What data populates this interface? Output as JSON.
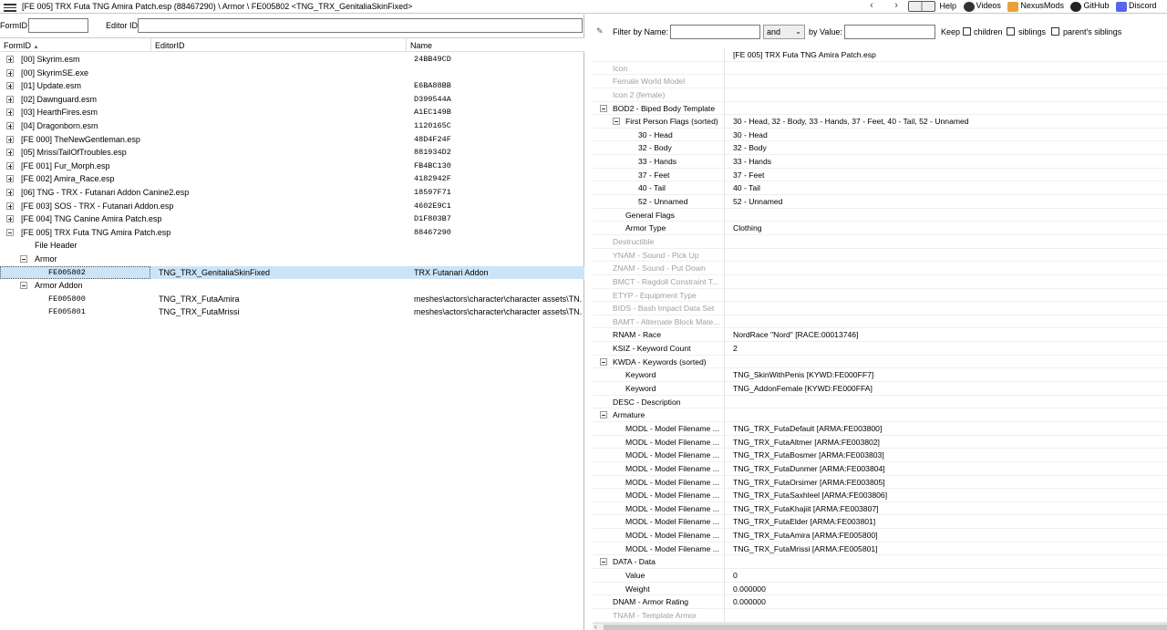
{
  "topbar": {
    "path": "[FE 005] TRX Futa TNG Amira Patch.esp (88467290) \\ Armor \\ FE005802 <TNG_TRX_GenitaliaSkinFixed>",
    "back": "‹",
    "forward": "›",
    "links": [
      {
        "label": "Help",
        "icon": "book-icon"
      },
      {
        "label": "Videos",
        "icon": "video-icon"
      },
      {
        "label": "NexusMods",
        "icon": "nexusmods-icon"
      },
      {
        "label": "GitHub",
        "icon": "github-icon"
      },
      {
        "label": "Discord",
        "icon": "discord-icon"
      }
    ]
  },
  "left": {
    "formid_label": "FormID",
    "editorid_label": "Editor ID",
    "formid_value": "",
    "editorid_value": "",
    "columns": [
      "FormID",
      "EditorID",
      "Name"
    ],
    "sort_indicator": "▲",
    "rows": [
      {
        "c1": "[00] Skyrim.esm",
        "c3": "24BB49CD",
        "indent": 0,
        "exp": "plus"
      },
      {
        "c1": "[00] SkyrimSE.exe",
        "c3": "",
        "indent": 0,
        "exp": "plus"
      },
      {
        "c1": "[01] Update.esm",
        "c3": "E6BA88BB",
        "indent": 0,
        "exp": "plus"
      },
      {
        "c1": "[02] Dawnguard.esm",
        "c3": "D399544A",
        "indent": 0,
        "exp": "plus"
      },
      {
        "c1": "[03] HearthFires.esm",
        "c3": "A1EC149B",
        "indent": 0,
        "exp": "plus"
      },
      {
        "c1": "[04] Dragonborn.esm",
        "c3": "1120165C",
        "indent": 0,
        "exp": "plus"
      },
      {
        "c1": "[FE 000] TheNewGentleman.esp",
        "c3": "48D4F24F",
        "indent": 0,
        "exp": "plus"
      },
      {
        "c1": "[05] MrissiTailOfTroubles.esp",
        "c3": "881934D2",
        "indent": 0,
        "exp": "plus"
      },
      {
        "c1": "[FE 001] Fur_Morph.esp",
        "c3": "FB4BC130",
        "indent": 0,
        "exp": "plus"
      },
      {
        "c1": "[FE 002] Amira_Race.esp",
        "c3": "4182942F",
        "indent": 0,
        "exp": "plus"
      },
      {
        "c1": "[06] TNG - TRX - Futanari Addon Canine2.esp",
        "c3": "18597F71",
        "indent": 0,
        "exp": "plus"
      },
      {
        "c1": "[FE 003] SOS - TRX - Futanari Addon.esp",
        "c3": "4602E9C1",
        "indent": 0,
        "exp": "plus"
      },
      {
        "c1": "[FE 004] TNG Canine Amira Patch.esp",
        "c3": "D1F803B7",
        "indent": 0,
        "exp": "plus"
      },
      {
        "c1": "[FE 005] TRX Futa TNG Amira Patch.esp",
        "c3": "88467290",
        "indent": 0,
        "exp": "minus"
      },
      {
        "c1": "File Header",
        "c3": "",
        "indent": 1,
        "exp": "none"
      },
      {
        "c1": "Armor",
        "c3": "",
        "indent": 1,
        "exp": "minus"
      },
      {
        "c1": "FE005802",
        "c2": "TNG_TRX_GenitaliaSkinFixed",
        "c3": "TRX Futanari Addon",
        "indent": 2,
        "exp": "none",
        "selected": true
      },
      {
        "c1": "Armor Addon",
        "c3": "",
        "indent": 1,
        "exp": "minus"
      },
      {
        "c1": "FE005800",
        "c2": "TNG_TRX_FutaAmira",
        "c3": "meshes\\actors\\character\\character assets\\TN...",
        "indent": 2,
        "exp": "none"
      },
      {
        "c1": "FE005801",
        "c2": "TNG_TRX_FutaMrissi",
        "c3": "meshes\\actors\\character\\character assets\\TN...",
        "indent": 2,
        "exp": "none"
      }
    ]
  },
  "right": {
    "filter_name_label": "Filter by Name:",
    "filter_name_value": "",
    "op_value": "and",
    "filter_value_label": "by Value:",
    "filter_value_value": "",
    "keep_label": "Keep",
    "children_label": "children",
    "siblings_label": "siblings",
    "parents_siblings_label": "parent's siblings",
    "rows": [
      {
        "k": "",
        "v": "[FE 005] TRX Futa TNG Amira Patch.esp",
        "level": 0
      },
      {
        "k": "Icon",
        "v": "",
        "level": 0,
        "dis": true
      },
      {
        "k": "Female World Model",
        "v": "",
        "level": 0,
        "dis": true
      },
      {
        "k": "Icon 2 (female)",
        "v": "",
        "level": 0,
        "dis": true
      },
      {
        "k": "BOD2 - Biped Body Template",
        "v": "",
        "level": 0,
        "exp": true
      },
      {
        "k": "First Person Flags (sorted)",
        "v": "30 - Head, 32 - Body, 33 - Hands, 37 - Feet, 40 - Tail, 52 - Unnamed",
        "level": 1,
        "exp": true
      },
      {
        "k": "30 - Head",
        "v": "30 - Head",
        "level": 2
      },
      {
        "k": "32 - Body",
        "v": "32 - Body",
        "level": 2
      },
      {
        "k": "33 - Hands",
        "v": "33 - Hands",
        "level": 2
      },
      {
        "k": "37 - Feet",
        "v": "37 - Feet",
        "level": 2
      },
      {
        "k": "40 - Tail",
        "v": "40 - Tail",
        "level": 2
      },
      {
        "k": "52 - Unnamed",
        "v": "52 - Unnamed",
        "level": 2
      },
      {
        "k": "General Flags",
        "v": "",
        "level": 1
      },
      {
        "k": "Armor Type",
        "v": "Clothing",
        "level": 1
      },
      {
        "k": "Destructible",
        "v": "",
        "level": 0,
        "dis": true
      },
      {
        "k": "YNAM - Sound - Pick Up",
        "v": "",
        "level": 0,
        "dis": true
      },
      {
        "k": "ZNAM - Sound - Put Down",
        "v": "",
        "level": 0,
        "dis": true
      },
      {
        "k": "BMCT - Ragdoll Constraint T...",
        "v": "",
        "level": 0,
        "dis": true
      },
      {
        "k": "ETYP - Equipment Type",
        "v": "",
        "level": 0,
        "dis": true
      },
      {
        "k": "BIDS - Bash Impact Data Set",
        "v": "",
        "level": 0,
        "dis": true
      },
      {
        "k": "BAMT - Alternate Block Mate...",
        "v": "",
        "level": 0,
        "dis": true
      },
      {
        "k": "RNAM - Race",
        "v": "NordRace \"Nord\" [RACE:00013746]",
        "level": 0
      },
      {
        "k": "KSIZ - Keyword Count",
        "v": "2",
        "level": 0
      },
      {
        "k": "KWDA - Keywords (sorted)",
        "v": "",
        "level": 0,
        "exp": true
      },
      {
        "k": "Keyword",
        "v": "TNG_SkinWithPenis [KYWD:FE000FF7]",
        "level": 1
      },
      {
        "k": "Keyword",
        "v": "TNG_AddonFemale [KYWD:FE000FFA]",
        "level": 1
      },
      {
        "k": "DESC - Description",
        "v": "",
        "level": 0
      },
      {
        "k": "Armature",
        "v": "",
        "level": 0,
        "exp": true
      },
      {
        "k": "MODL - Model Filename ...",
        "v": "TNG_TRX_FutaDefault [ARMA:FE003800]",
        "level": 1
      },
      {
        "k": "MODL - Model Filename ...",
        "v": "TNG_TRX_FutaAltmer [ARMA:FE003802]",
        "level": 1
      },
      {
        "k": "MODL - Model Filename ...",
        "v": "TNG_TRX_FutaBosmer [ARMA:FE003803]",
        "level": 1
      },
      {
        "k": "MODL - Model Filename ...",
        "v": "TNG_TRX_FutaDunmer [ARMA:FE003804]",
        "level": 1
      },
      {
        "k": "MODL - Model Filename ...",
        "v": "TNG_TRX_FutaOrsimer [ARMA:FE003805]",
        "level": 1
      },
      {
        "k": "MODL - Model Filename ...",
        "v": "TNG_TRX_FutaSaxhleel [ARMA:FE003806]",
        "level": 1
      },
      {
        "k": "MODL - Model Filename ...",
        "v": "TNG_TRX_FutaKhajiit [ARMA:FE003807]",
        "level": 1
      },
      {
        "k": "MODL - Model Filename ...",
        "v": "TNG_TRX_FutaElder [ARMA:FE003801]",
        "level": 1
      },
      {
        "k": "MODL - Model Filename ...",
        "v": "TNG_TRX_FutaAmira [ARMA:FE005800]",
        "level": 1
      },
      {
        "k": "MODL - Model Filename ...",
        "v": "TNG_TRX_FutaMrissi [ARMA:FE005801]",
        "level": 1
      },
      {
        "k": "DATA - Data",
        "v": "",
        "level": 0,
        "exp": true
      },
      {
        "k": "Value",
        "v": "0",
        "level": 1
      },
      {
        "k": "Weight",
        "v": "0.000000",
        "level": 1
      },
      {
        "k": "DNAM - Armor Rating",
        "v": "0.000000",
        "level": 0
      },
      {
        "k": "TNAM - Template Armor",
        "v": "",
        "level": 0,
        "dis": true
      }
    ]
  }
}
